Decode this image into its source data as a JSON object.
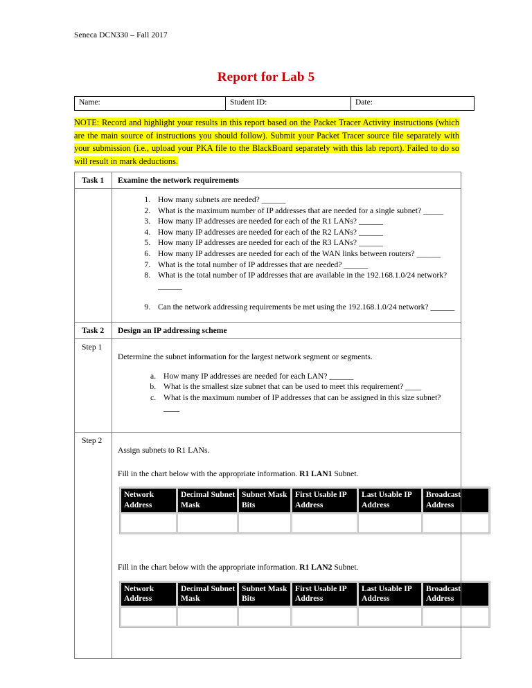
{
  "document": {
    "running_header": "Seneca DCN330 – Fall 2017",
    "title": "Report for Lab 5",
    "title_color": "#c00000",
    "highlight_color": "#ffff00"
  },
  "identity_row": {
    "name_label": "Name:",
    "student_id_label": "Student ID:",
    "date_label": "Date:"
  },
  "note": {
    "text": "NOTE: Record and highlight your results in this report based on the Packet Tracer Activity instructions (which are the main source of instructions you should follow). Submit your Packet Tracer source file separately with your submission (i.e., upload your PKA file to the BlackBoard separately with this lab report). Failed to do so will result in mark deductions."
  },
  "task1": {
    "label": "Task 1",
    "heading": "Examine the network requirements",
    "questions": [
      "How many subnets are needed?  ______",
      "What is the maximum number of IP addresses that are needed for a single subnet?  _____",
      "How many IP addresses are needed for each of the R1 LANs?  ______",
      "How many IP addresses are needed for each of the R2 LANs?  ______",
      "How many IP addresses are needed for each of the R3 LANs?  ______",
      "How many IP addresses are needed for each of the WAN links between routers?  ______",
      "What is the total number of IP addresses that are needed?  ______",
      "What is the total number of IP addresses that are available in the 192.168.1.0/24 network?  ______",
      "Can the network addressing requirements be met using the 192.168.1.0/24 network?  ______"
    ]
  },
  "task2": {
    "label": "Task 2",
    "heading": "Design an IP addressing scheme"
  },
  "step1": {
    "label": "Step 1",
    "intro": "Determine the subnet information for the largest network segment or segments.",
    "questions": [
      "How many IP addresses are needed for each LAN?  ______",
      "What is the smallest size subnet that can be used to meet this requirement?  ____",
      "What is the maximum number of IP addresses that can be assigned in this size subnet?  ____"
    ]
  },
  "step2": {
    "label": "Step 2",
    "intro": "Assign subnets to R1 LANs.",
    "charts": [
      {
        "caption_prefix": "Fill in the chart below with the appropriate information. ",
        "caption_bold": "R1 LAN1",
        "caption_suffix": " Subnet.",
        "columns": [
          "Network Address",
          "Decimal Subnet Mask",
          "Subnet Mask Bits",
          "First Usable IP Address",
          "Last Usable IP Address",
          "Broadcast Address"
        ],
        "rows": [
          [
            "",
            "",
            "",
            "",
            "",
            ""
          ]
        ]
      },
      {
        "caption_prefix": "Fill in the chart below with the appropriate information. ",
        "caption_bold": "R1 LAN2",
        "caption_suffix": " Subnet.",
        "columns": [
          "Network Address",
          "Decimal Subnet Mask",
          "Subnet Mask Bits",
          "First Usable IP Address",
          "Last Usable IP Address",
          "Broadcast Address"
        ],
        "rows": [
          [
            "",
            "",
            "",
            "",
            "",
            ""
          ]
        ]
      }
    ]
  }
}
